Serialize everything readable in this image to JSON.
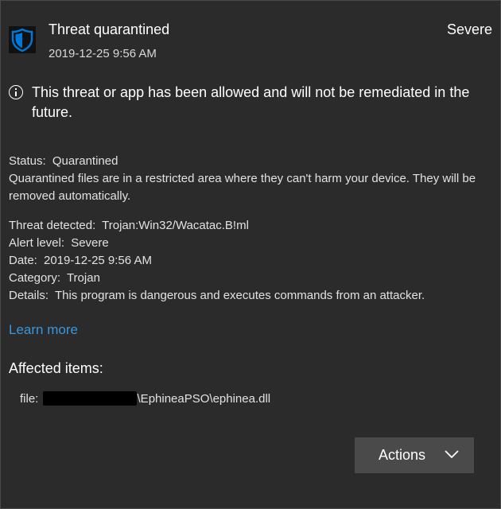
{
  "header": {
    "icon": "shield-icon",
    "title": "Threat quarantined",
    "timestamp": "2019-12-25 9:56 AM",
    "severity": "Severe"
  },
  "notice": {
    "icon": "info-icon",
    "text": "This threat or app has been allowed and will not be remediated in the future."
  },
  "details": {
    "status_label": "Status:",
    "status_value": "Quarantined",
    "status_description": "Quarantined files are in a restricted area where they can't harm your device. They will be removed automatically.",
    "threat_label": "Threat detected:",
    "threat_value": "Trojan:Win32/Wacatac.B!ml",
    "alert_label": "Alert level:",
    "alert_value": "Severe",
    "date_label": "Date:",
    "date_value": "2019-12-25 9:56 AM",
    "category_label": "Category:",
    "category_value": "Trojan",
    "details_label": "Details:",
    "details_value": "This program is dangerous and executes commands from an attacker."
  },
  "links": {
    "learn_more": "Learn more"
  },
  "affected": {
    "title": "Affected items:",
    "item_prefix": "file:",
    "item_suffix": "\\EphineaPSO\\ephinea.dll"
  },
  "actions": {
    "label": "Actions",
    "icon": "chevron-down-icon"
  },
  "colors": {
    "background": "#2b2b2b",
    "accent_link": "#3a96dd",
    "button_bg": "#4a4a4a",
    "shield_blue": "#0078d7"
  }
}
